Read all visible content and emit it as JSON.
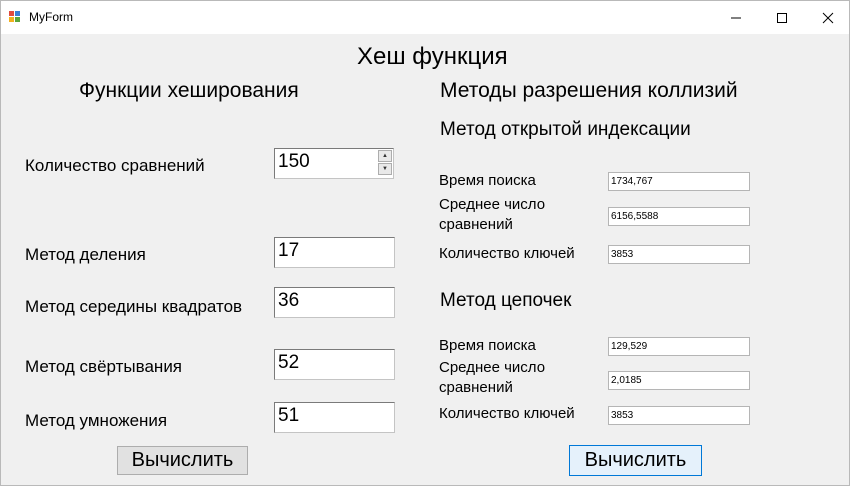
{
  "window": {
    "title": "MyForm",
    "controls": {
      "minimize": "minimize-icon",
      "maximize": "maximize-icon",
      "close": "close-icon"
    }
  },
  "header": {
    "title": "Хеш функция"
  },
  "left": {
    "section_title": "Функции хеширования",
    "comparisons_label": "Количество сравнений",
    "comparisons_value": "150",
    "rows": [
      {
        "label": "Метод деления",
        "value": "17"
      },
      {
        "label": "Метод середины квадратов",
        "value": "36"
      },
      {
        "label": "Метод свёртывания",
        "value": "52"
      },
      {
        "label": "Метод умножения",
        "value": "51"
      }
    ],
    "compute_label": "Вычислить"
  },
  "right": {
    "section_title": "Методы разрешения коллизий",
    "open_indexing": {
      "title": "Метод открытой индексации",
      "search_time_label": "Время поиска",
      "search_time_value": "1734,767",
      "avg_comparisons_label": "Среднее число сравнений",
      "avg_comparisons_value": "6156,5588",
      "key_count_label": "Количество ключей",
      "key_count_value": "3853"
    },
    "chaining": {
      "title": "Метод цепочек",
      "search_time_label": "Время поиска",
      "search_time_value": "129,529",
      "avg_comparisons_label": "Среднее число сравнений",
      "avg_comparisons_value": "2,0185",
      "key_count_label": "Количество ключей",
      "key_count_value": "3853"
    },
    "compute_label": "Вычислить"
  },
  "colors": {
    "window_bg": "#f0f0f0",
    "titlebar_bg": "#ffffff",
    "focus_border": "#0078d7"
  }
}
